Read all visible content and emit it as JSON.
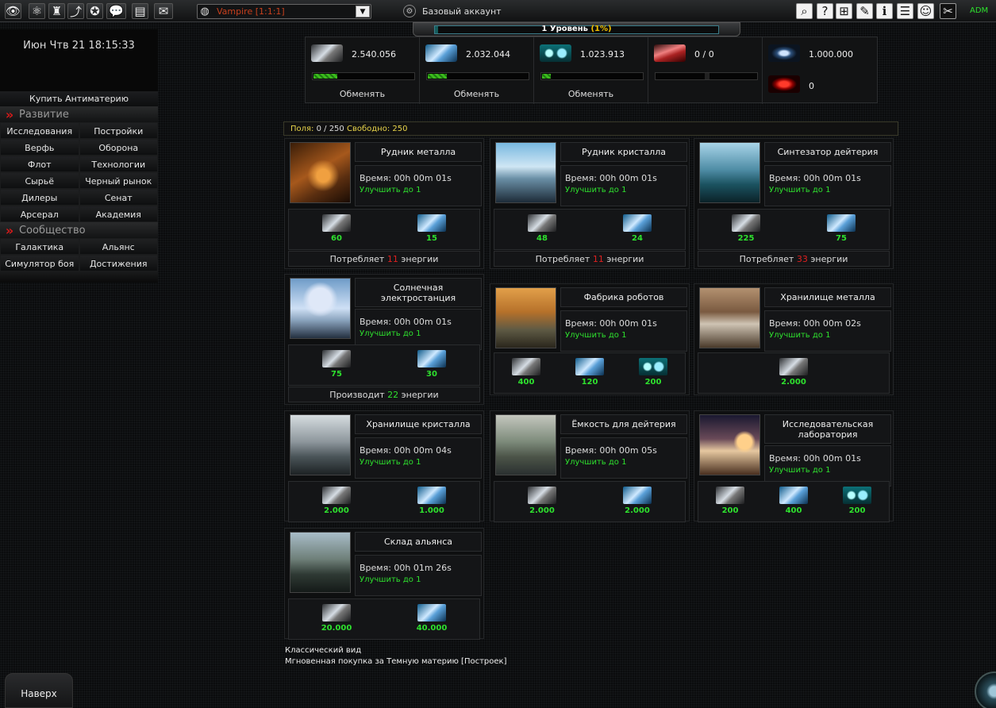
{
  "topbar": {
    "icons": [
      "eye-icon",
      "atom-icon",
      "rank-icon",
      "stats-icon",
      "medal-icon",
      "chat-icon",
      "message-icon",
      "mail-icon"
    ],
    "planet_selector": "Vampire [1:1:1]",
    "account_type": "Базовый аккаунт",
    "right_icons": [
      "search-icon",
      "help-icon",
      "network-icon",
      "notes-icon",
      "info-icon",
      "document-icon",
      "user-icon",
      "tools-icon"
    ],
    "admin_label": "ADM"
  },
  "level": {
    "text": "1 Уровень",
    "percent": "(1%)",
    "progress": 0.01
  },
  "clock": "Июн Чтв 21 18:15:33",
  "sidebar": {
    "buy_antimatter": "Купить Антиматерию",
    "section_development": "Развитие",
    "dev_rows": [
      [
        "Исследования",
        "Постройки"
      ],
      [
        "Верфь",
        "Оборона"
      ],
      [
        "Флот",
        "Технологии"
      ],
      [
        "Сырьё",
        "Черный рынок"
      ],
      [
        "Дилеры",
        "Сенат"
      ],
      [
        "Арсерал",
        "Академия"
      ]
    ],
    "section_community": "Сообщество",
    "comm_rows": [
      [
        "Галактика",
        "Альянс"
      ],
      [
        "Симулятор боя",
        "Достижения"
      ]
    ]
  },
  "resources": {
    "metal": {
      "value": "2.540.056",
      "fill": 0.25,
      "exchange": "Обменять"
    },
    "crystal": {
      "value": "2.032.044",
      "fill": 0.2,
      "exchange": "Обменять"
    },
    "deuterium": {
      "value": "1.023.913",
      "fill": 0.1,
      "exchange": "Обменять"
    },
    "energy": {
      "value": "0 / 0"
    },
    "dark_matter": {
      "value": "1.000.000"
    },
    "red_matter": {
      "value": "0"
    }
  },
  "fields": {
    "label": "Поля:",
    "value": "0 / 250",
    "free_label": "Свободно:",
    "free_value": "250"
  },
  "buildings": [
    {
      "name": "Рудник металла",
      "time": "Время: 00h 00m 01s",
      "upgrade": "Улучшить до 1",
      "costs": [
        {
          "res": "metal",
          "v": "60"
        },
        {
          "res": "crystal",
          "v": "15"
        }
      ],
      "energy_pre": "Потребляет",
      "energy_val": "11",
      "energy_post": "энергии",
      "energy_kind": "consume"
    },
    {
      "name": "Рудник кристалла",
      "time": "Время: 00h 00m 01s",
      "upgrade": "Улучшить до 1",
      "costs": [
        {
          "res": "metal",
          "v": "48"
        },
        {
          "res": "crystal",
          "v": "24"
        }
      ],
      "energy_pre": "Потребляет",
      "energy_val": "11",
      "energy_post": "энергии",
      "energy_kind": "consume"
    },
    {
      "name": "Синтезатор дейтерия",
      "time": "Время: 00h 00m 01s",
      "upgrade": "Улучшить до 1",
      "costs": [
        {
          "res": "metal",
          "v": "225"
        },
        {
          "res": "crystal",
          "v": "75"
        }
      ],
      "energy_pre": "Потребляет",
      "energy_val": "33",
      "energy_post": "энергии",
      "energy_kind": "consume"
    },
    {
      "name": "Солнечная электростанция",
      "time": "Время: 00h 00m 01s",
      "upgrade": "Улучшить до 1",
      "costs": [
        {
          "res": "metal",
          "v": "75"
        },
        {
          "res": "crystal",
          "v": "30"
        }
      ],
      "energy_pre": "Производит",
      "energy_val": "22",
      "energy_post": "энергии",
      "energy_kind": "produce"
    },
    {
      "name": "Фабрика роботов",
      "time": "Время: 00h 00m 01s",
      "upgrade": "Улучшить до 1",
      "costs": [
        {
          "res": "metal",
          "v": "400"
        },
        {
          "res": "crystal",
          "v": "120"
        },
        {
          "res": "deuterium",
          "v": "200"
        }
      ]
    },
    {
      "name": "Хранилище металла",
      "time": "Время: 00h 00m 02s",
      "upgrade": "Улучшить до 1",
      "costs": [
        {
          "res": "metal",
          "v": "2.000"
        }
      ]
    },
    {
      "name": "Хранилище кристалла",
      "time": "Время: 00h 00m 04s",
      "upgrade": "Улучшить до 1",
      "costs": [
        {
          "res": "metal",
          "v": "2.000"
        },
        {
          "res": "crystal",
          "v": "1.000"
        }
      ]
    },
    {
      "name": "Ёмкость для дейтерия",
      "time": "Время: 00h 00m 05s",
      "upgrade": "Улучшить до 1",
      "costs": [
        {
          "res": "metal",
          "v": "2.000"
        },
        {
          "res": "crystal",
          "v": "2.000"
        }
      ]
    },
    {
      "name": "Исследовательская лаборатория",
      "time": "Время: 00h 00m 01s",
      "upgrade": "Улучшить до 1",
      "costs": [
        {
          "res": "metal",
          "v": "200"
        },
        {
          "res": "crystal",
          "v": "400"
        },
        {
          "res": "deuterium",
          "v": "200"
        }
      ]
    },
    {
      "name": "Склад альянса",
      "time": "Время: 00h 01m 26s",
      "upgrade": "Улучшить до 1",
      "costs": [
        {
          "res": "metal",
          "v": "20.000"
        },
        {
          "res": "crystal",
          "v": "40.000"
        }
      ]
    }
  ],
  "footer": {
    "classic_view": "Классический вид",
    "instant_buy": "Мгновенная покупка за Темную материю [Построек]",
    "top_button": "Наверх"
  }
}
